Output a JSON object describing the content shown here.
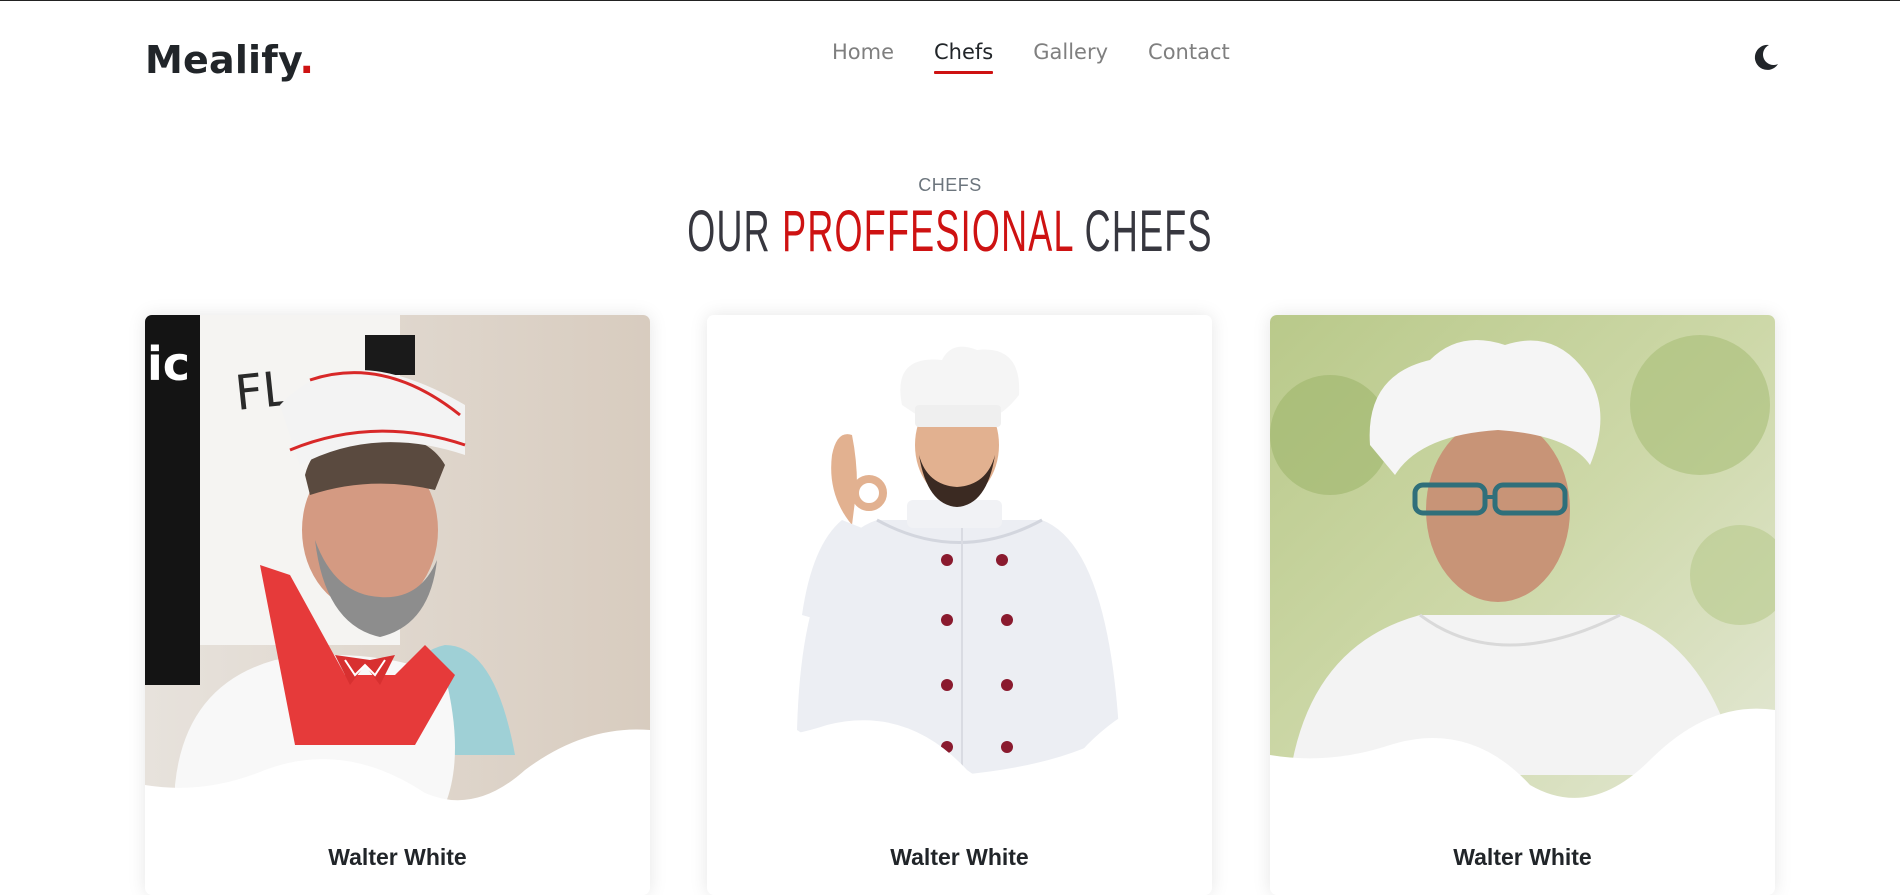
{
  "brand": {
    "name": "Mealify",
    "dot": "."
  },
  "nav": {
    "items": [
      {
        "label": "Home",
        "active": false
      },
      {
        "label": "Chefs",
        "active": true
      },
      {
        "label": "Gallery",
        "active": false
      },
      {
        "label": "Contact",
        "active": false
      }
    ]
  },
  "theme_toggle": {
    "icon": "moon-icon"
  },
  "section": {
    "eyebrow": "CHEFS",
    "title_part1": "OUR ",
    "title_accent": "PROFFESIONAL",
    "title_part2": " CHEFS"
  },
  "chefs": [
    {
      "name": "Walter White",
      "photo": "chef-photo-red-apron"
    },
    {
      "name": "Walter White",
      "photo": "chef-photo-ok-gesture"
    },
    {
      "name": "Walter White",
      "photo": "chef-photo-glasses"
    }
  ],
  "colors": {
    "accent": "#ce1212",
    "text": "#212529",
    "nav_muted": "#7f7f7f"
  }
}
